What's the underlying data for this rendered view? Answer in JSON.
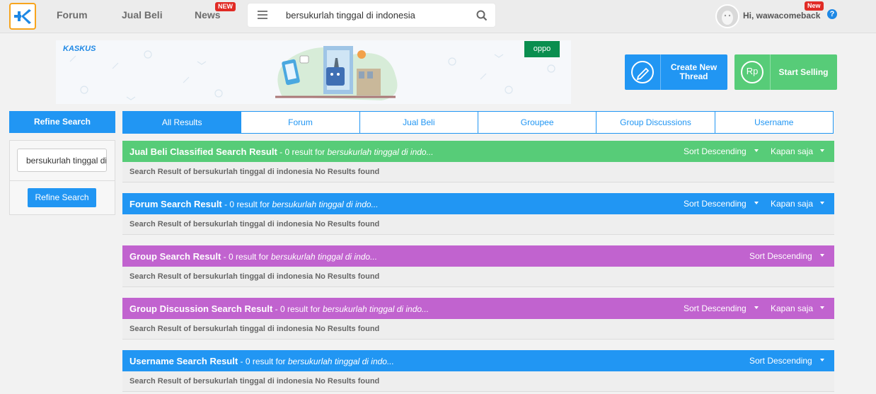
{
  "nav": {
    "forum": "Forum",
    "jual_beli": "Jual Beli",
    "news": "News",
    "news_badge": "NEW",
    "search_value": "bersukurlah tinggal di indonesia",
    "user_greeting": "Hi, wawacomeback",
    "user_badge": "New",
    "help": "?"
  },
  "banner": {
    "brand": "KASKUS",
    "partner": "oppo"
  },
  "actions": {
    "create_thread": "Create New Thread",
    "start_selling": "Start Selling",
    "rp": "Rp"
  },
  "refine": {
    "header": "Refine Search",
    "input_value": "bersukurlah tinggal di indonesia",
    "button": "Refine Search"
  },
  "tabs": [
    "All Results",
    "Forum",
    "Jual Beli",
    "Groupee",
    "Group Discussions",
    "Username"
  ],
  "sections": [
    {
      "title": "Jual Beli Classified Search Result",
      "count": " - 0 result for ",
      "query": "bersukurlah tinggal di indo...",
      "sort": "Sort Descending",
      "time": "Kapan saja",
      "body": "Search Result of bersukurlah tinggal di indonesia No Results found",
      "color": "#57cc78"
    },
    {
      "title": "Forum Search Result",
      "count": " - 0 result for ",
      "query": "bersukurlah tinggal di indo...",
      "sort": "Sort Descending",
      "time": "Kapan saja",
      "body": "Search Result of bersukurlah tinggal di indonesia No Results found",
      "color": "#2196f3"
    },
    {
      "title": "Group Search Result",
      "count": " - 0 result for ",
      "query": "bersukurlah tinggal di indo...",
      "sort": "Sort Descending",
      "body": "Search Result of bersukurlah tinggal di indonesia No Results found",
      "color": "#c163cf"
    },
    {
      "title": "Group Discussion Search Result",
      "count": " - 0 result for ",
      "query": "bersukurlah tinggal di indo...",
      "sort": "Sort Descending",
      "time": "Kapan saja",
      "body": "Search Result of bersukurlah tinggal di indonesia No Results found",
      "color": "#c163cf"
    },
    {
      "title": "Username Search Result",
      "count": " - 0 result for ",
      "query": "bersukurlah tinggal di indo...",
      "sort": "Sort Descending",
      "body": "Search Result of bersukurlah tinggal di indonesia No Results found",
      "color": "#2196f3"
    }
  ],
  "colors": {
    "primary": "#2196f3",
    "green": "#57cc78",
    "purple": "#c163cf",
    "logo_border": "#f7a41d",
    "badge": "#e12b25"
  }
}
